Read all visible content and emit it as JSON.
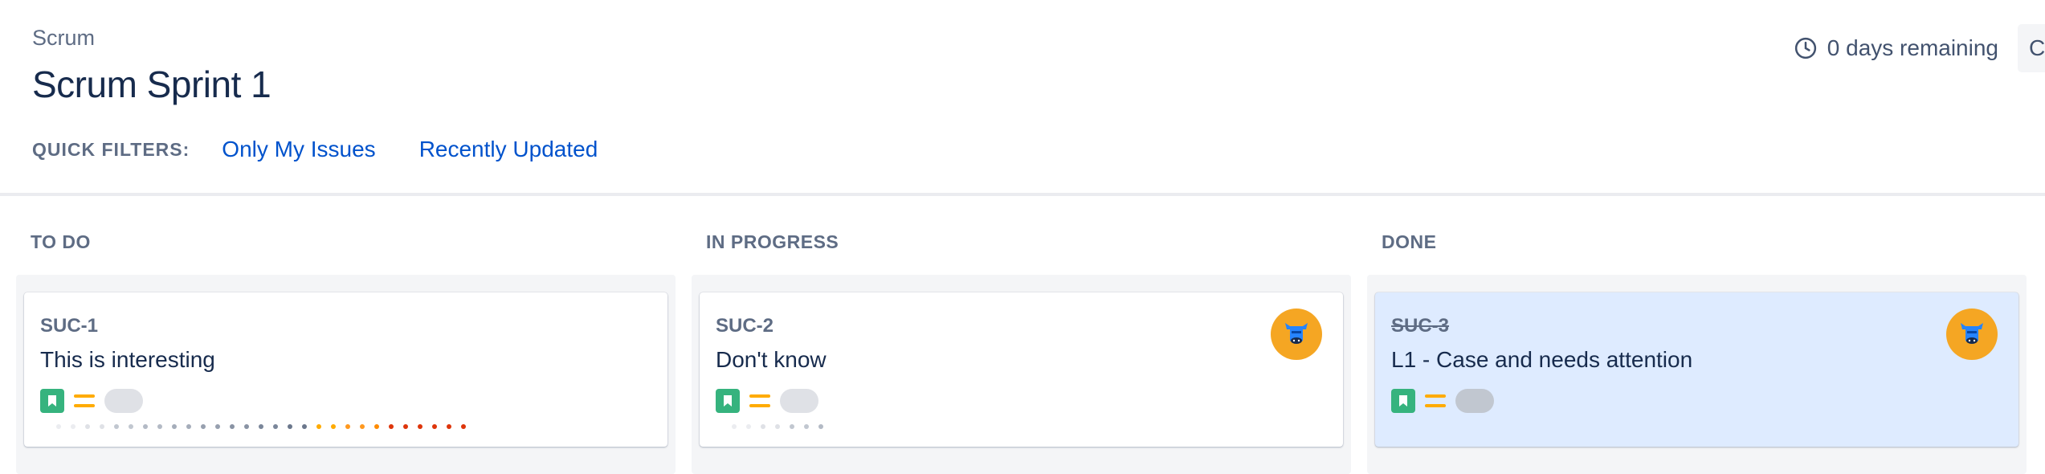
{
  "header": {
    "project_name": "Scrum",
    "sprint_title": "Scrum Sprint 1",
    "remaining": "0 days remaining",
    "complete_button": "Complete sprint"
  },
  "quick_filters": {
    "label": "QUICK FILTERS:",
    "items": [
      "Only My Issues",
      "Recently Updated"
    ]
  },
  "columns": [
    {
      "title": "TO DO",
      "cards": [
        {
          "key": "SUC-1",
          "summary": "This is interesting",
          "type_icon": "story-icon",
          "priority_icon": "medium-priority-icon",
          "has_avatar": false,
          "days_in_column_dots": [
            "#ebecf0",
            "#ebecf0",
            "#dfe1e6",
            "#dfe1e6",
            "#c1c7d0",
            "#c1c7d0",
            "#b3bac5",
            "#b3bac5",
            "#a5adba",
            "#a5adba",
            "#97a0af",
            "#97a0af",
            "#8993a4",
            "#8993a4",
            "#7a869a",
            "#7a869a",
            "#6b778c",
            "#6b778c",
            "#ffab00",
            "#ffab00",
            "#ff991f",
            "#ff991f",
            "#ff8b00",
            "#de350b",
            "#de350b",
            "#de350b",
            "#de350b",
            "#de350b",
            "#de350b"
          ]
        }
      ]
    },
    {
      "title": "IN PROGRESS",
      "cards": [
        {
          "key": "SUC-2",
          "summary": "Don't know",
          "type_icon": "story-icon",
          "priority_icon": "medium-priority-icon",
          "has_avatar": true,
          "days_in_column_dots": [
            "#ebecf0",
            "#ebecf0",
            "#dfe1e6",
            "#dfe1e6",
            "#c1c7d0",
            "#c1c7d0",
            "#b3bac5"
          ]
        }
      ]
    },
    {
      "title": "DONE",
      "cards": [
        {
          "key": "SUC-3",
          "summary": "L1 - Case and needs attention",
          "type_icon": "story-icon",
          "priority_icon": "medium-priority-icon",
          "has_avatar": true,
          "resolved": true,
          "days_in_column_dots": []
        }
      ]
    }
  ],
  "colors": {
    "accent_link": "#0052cc",
    "story_green": "#36b37e",
    "priority_orange": "#ffab00",
    "done_card_bg": "#deebff",
    "avatar_bg": "#f5a623"
  }
}
